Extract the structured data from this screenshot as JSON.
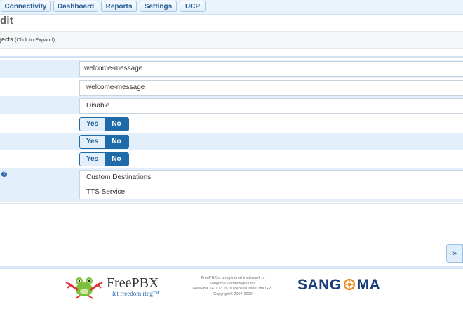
{
  "nav": {
    "tabs": [
      "Connectivity",
      "Dashboard",
      "Reports",
      "Settings",
      "UCP"
    ]
  },
  "page": {
    "title": "dit"
  },
  "section": {
    "title": "jects",
    "hint": "(Click to Expand)"
  },
  "form": {
    "field1_value": "welcome-message",
    "field2_value": "welcome-message",
    "field3_value": "Disable",
    "toggle_yes": "Yes",
    "toggle_no": "No",
    "toggles_selected": [
      "No",
      "No",
      "No"
    ],
    "help_icon": "?",
    "destinations": [
      "Custom Destinations",
      "TTS Service"
    ]
  },
  "controls": {
    "forward": "»"
  },
  "footer": {
    "brand": "FreePBX",
    "tagline": "let freedom ring™",
    "legal": [
      "FreePBX is a registered trademark of",
      "Sangoma Technologies Inc.",
      "FreePBX 14.0.13.28 is licensed under the GPL",
      "Copyright© 2007-2020"
    ],
    "sangoma_pre": "SANG",
    "sangoma_post": "MA"
  },
  "colors": {
    "accent": "#1f6aa8",
    "row_blue": "#e3effa",
    "nav_bg": "#eaf3fb"
  }
}
